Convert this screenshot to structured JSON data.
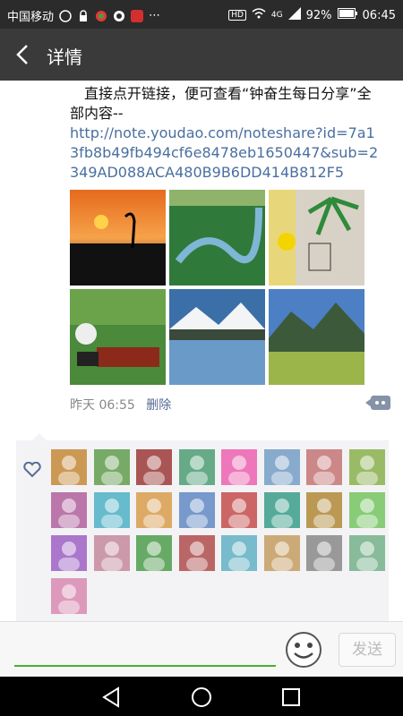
{
  "status": {
    "carrier": "中国移动",
    "mail_icon": "mail-icon",
    "app_icons": [
      "lock-icon",
      "pinwheel-icon",
      "q-icon",
      "mail-app-icon",
      "more-icon"
    ],
    "hd": "HD",
    "network": "4G",
    "battery": "92%",
    "time": "06:45"
  },
  "header": {
    "title": "详情",
    "back_icon": "back-arrow-icon"
  },
  "post": {
    "text": "直接点开链接，便可查看“钟奋生每日分享”全部内容--",
    "link": "http://note.youdao.com/noteshare?id=7a13fb8b49fb494cf6e8478eb1650447&sub=2349AD088ACA480B9B6DD414B812F5",
    "time": "昨天 06:55",
    "delete_label": "删除",
    "comment_icon": "comment-icon"
  },
  "likes": {
    "heart_icon": "heart-icon",
    "count_avatars": 25
  },
  "input": {
    "emoji_icon": "emoji-icon",
    "send_label": "发送"
  },
  "nav": {
    "back": "nav-back-icon",
    "home": "nav-home-icon",
    "recent": "nav-recent-icon"
  }
}
